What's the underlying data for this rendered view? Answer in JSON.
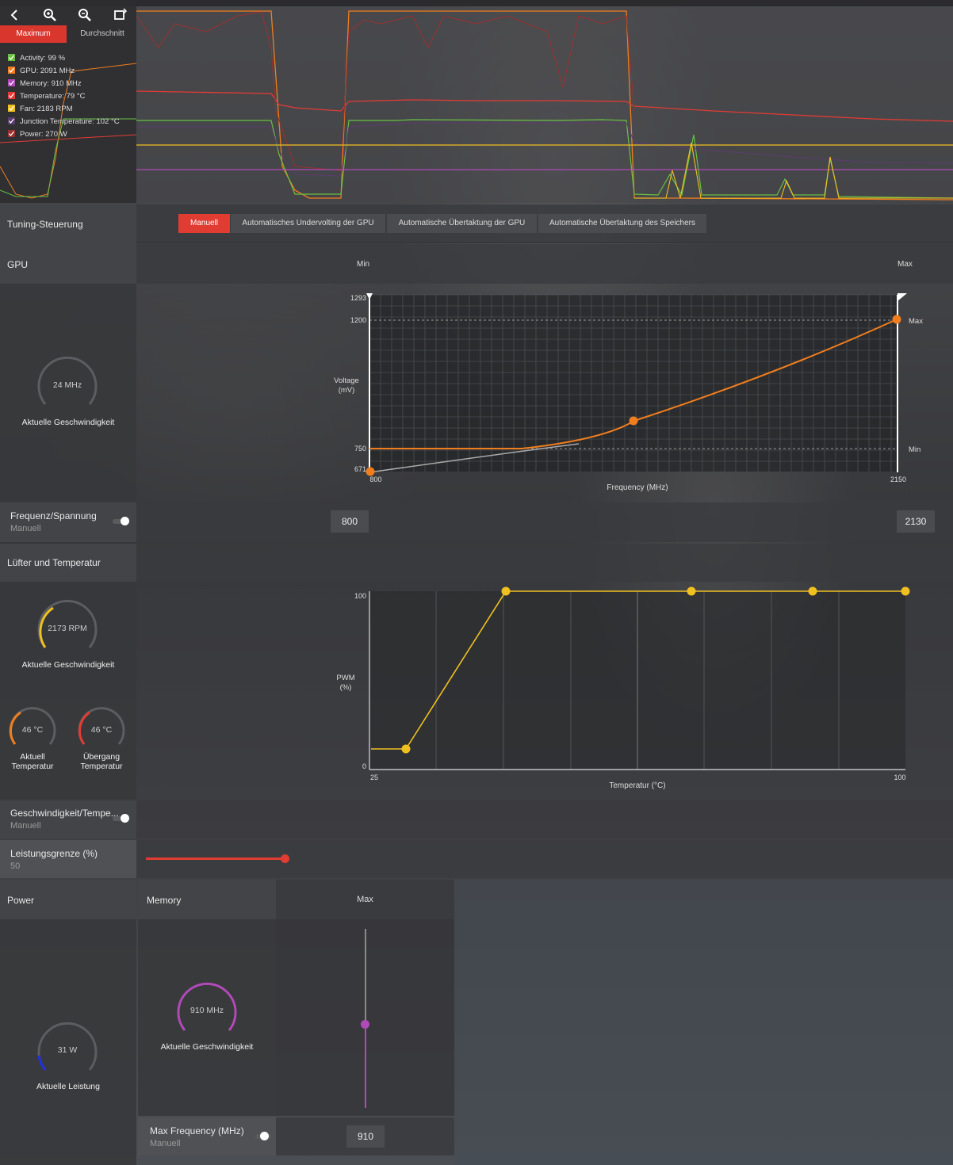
{
  "toolbar": {
    "icons": [
      "back-icon",
      "zoom-in-icon",
      "zoom-out-icon",
      "reset-zoom-icon"
    ],
    "tab_max": "Maximum",
    "tab_avg": "Durchschnitt"
  },
  "legend": [
    {
      "text": "Activity: 99 %",
      "color": "#69c043"
    },
    {
      "text": "GPU: 2091 MHz",
      "color": "#f07e1e"
    },
    {
      "text": "Memory: 910 MHz",
      "color": "#b04ab8"
    },
    {
      "text": "Temperature: 79 °C",
      "color": "#e23b35"
    },
    {
      "text": "Fan: 2183 RPM",
      "color": "#f0c020"
    },
    {
      "text": "Junction Temperature: 102 °C",
      "color": "#5b3c6e"
    },
    {
      "text": "Power: 270 W",
      "color": "#9a3030"
    }
  ],
  "tuning": {
    "label": "Tuning-Steuerung",
    "tabs": [
      "Manuell",
      "Automatisches Undervolting der GPU",
      "Automatische Übertaktung der GPU",
      "Automatische Übertaktung des Speichers"
    ]
  },
  "gpu": {
    "label": "GPU",
    "min_label": "Min",
    "max_label": "Max",
    "gauge_value": "24 MHz",
    "gauge_caption": "Aktuelle Geschwindigkeit",
    "curve": {
      "y_ticks": [
        "1293",
        "1200",
        "750",
        "671"
      ],
      "x_ticks": [
        "800",
        "2150"
      ],
      "ylabel": "Voltage\n(mV)",
      "xlabel": "Frequency (MHz)",
      "max_marker": "Max",
      "min_marker": "Min"
    },
    "freq_label": "Frequenz/Spannung",
    "freq_sub": "Manuell",
    "min_value": "800",
    "max_value": "2130"
  },
  "fan": {
    "label": "Lüfter und Temperatur",
    "gauge_value": "2173 RPM",
    "gauge_caption": "Aktuelle Geschwindigkeit",
    "temp1_value": "46 °C",
    "temp1_caption": "Aktuell\nTemperatur",
    "temp2_value": "46 °C",
    "temp2_caption": "Übergang\nTemperatur",
    "curve": {
      "y_ticks": [
        "100",
        "0"
      ],
      "x_ticks": [
        "25",
        "100"
      ],
      "ylabel": "PWM\n(%)",
      "xlabel": "Temperatur (°C)"
    },
    "speed_label": "Geschwindigkeit/Tempe...",
    "speed_sub": "Manuell"
  },
  "power_limit": {
    "label": "Leistungsgrenze (%)",
    "value": "50",
    "accent": "#e03c31"
  },
  "power": {
    "label": "Power",
    "gauge_value": "31 W",
    "gauge_caption": "Aktuelle Leistung"
  },
  "memory": {
    "label": "Memory",
    "max_label": "Max",
    "gauge_value": "910 MHz",
    "gauge_caption": "Aktuelle Geschwindigkeit",
    "freq_label": "Max Frequency (MHz)",
    "freq_sub": "Manuell",
    "freq_value": "910"
  },
  "chart_data": [
    {
      "type": "line",
      "title": "",
      "xlabel": "Frequency (MHz)",
      "ylabel": "Voltage (mV)",
      "xlim": [
        800,
        2150
      ],
      "ylim": [
        671,
        1293
      ],
      "series": [
        {
          "x": [
            800,
            1200,
            1600,
            2130
          ],
          "y": [
            671,
            750,
            850,
            1200
          ]
        }
      ],
      "control_points": [
        {
          "x": 800,
          "y": 671
        },
        {
          "x": 1448,
          "y": 854
        },
        {
          "x": 2130,
          "y": 1200
        }
      ]
    },
    {
      "type": "line",
      "title": "",
      "xlabel": "Temperatur (°C)",
      "ylabel": "PWM (%)",
      "xlim": [
        25,
        100
      ],
      "ylim": [
        0,
        100
      ],
      "series": [
        {
          "x": [
            25,
            30,
            44,
            69,
            86,
            100
          ],
          "y": [
            12,
            12,
            100,
            100,
            100,
            100
          ]
        }
      ]
    }
  ]
}
